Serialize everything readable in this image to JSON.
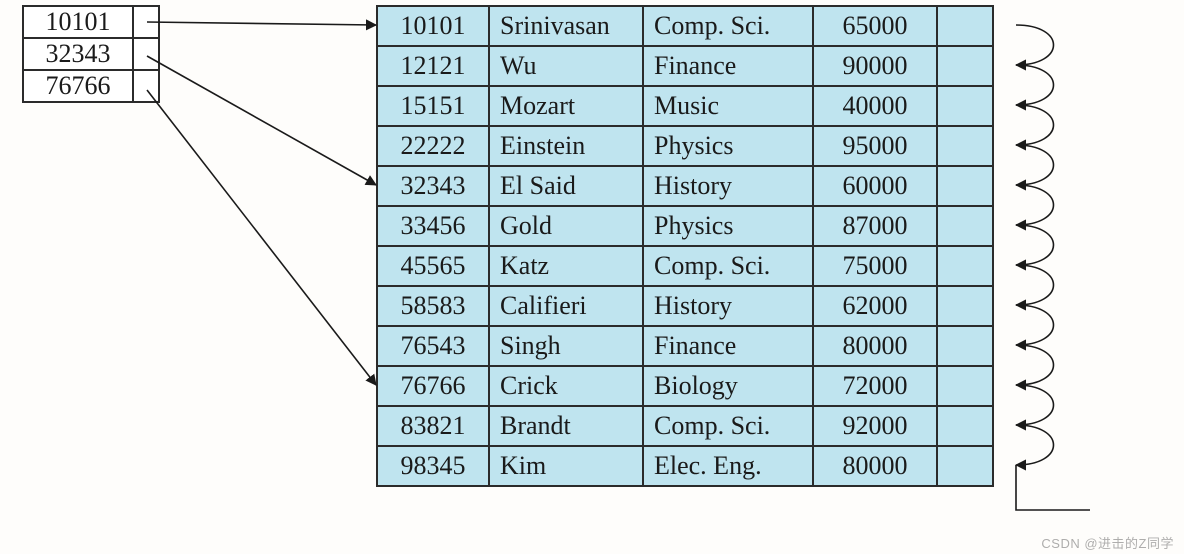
{
  "index": [
    {
      "key": "10101"
    },
    {
      "key": "32343"
    },
    {
      "key": "76766"
    }
  ],
  "records": [
    {
      "id": "10101",
      "name": "Srinivasan",
      "dept": "Comp. Sci.",
      "salary": "65000"
    },
    {
      "id": "12121",
      "name": "Wu",
      "dept": "Finance",
      "salary": "90000"
    },
    {
      "id": "15151",
      "name": "Mozart",
      "dept": "Music",
      "salary": "40000"
    },
    {
      "id": "22222",
      "name": "Einstein",
      "dept": "Physics",
      "salary": "95000"
    },
    {
      "id": "32343",
      "name": "El Said",
      "dept": "History",
      "salary": "60000"
    },
    {
      "id": "33456",
      "name": "Gold",
      "dept": "Physics",
      "salary": "87000"
    },
    {
      "id": "45565",
      "name": "Katz",
      "dept": "Comp. Sci.",
      "salary": "75000"
    },
    {
      "id": "58583",
      "name": "Califieri",
      "dept": "History",
      "salary": "62000"
    },
    {
      "id": "76543",
      "name": "Singh",
      "dept": "Finance",
      "salary": "80000"
    },
    {
      "id": "76766",
      "name": "Crick",
      "dept": "Biology",
      "salary": "72000"
    },
    {
      "id": "83821",
      "name": "Brandt",
      "dept": "Comp. Sci.",
      "salary": "92000"
    },
    {
      "id": "98345",
      "name": "Kim",
      "dept": "Elec. Eng.",
      "salary": "80000"
    }
  ],
  "watermark": "CSDN @进击的Z同学"
}
